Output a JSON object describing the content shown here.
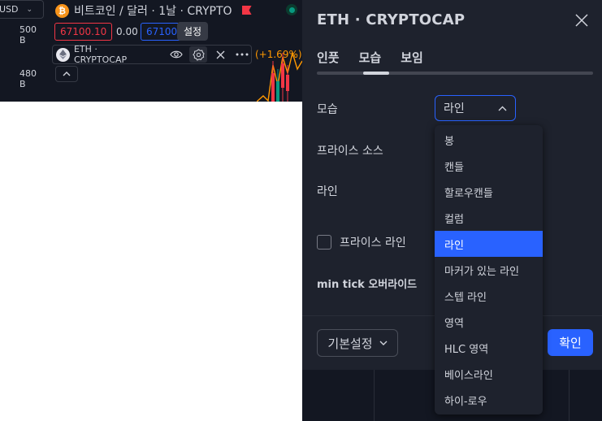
{
  "chart": {
    "currency": "USD",
    "y_labels": [
      "500 B",
      "480 B"
    ],
    "symbol_title": "비트코인 / 달러 · 1날 · CRYPTO",
    "btc_glyph": "₿",
    "sell_price": "67100.10",
    "spread": "0.00",
    "buy_price": "67100.",
    "tooltip": "설정",
    "legend_symbol": "ETH · CRYPTOCAP",
    "legend_change": "(+1.69%)",
    "collapse_glyph": "^",
    "accent_colors": {
      "sell": "#f23645",
      "buy": "#2962ff",
      "change": "#ff9800",
      "live": "#089981"
    }
  },
  "dialog": {
    "title": "ETH · CRYPTOCAP",
    "tabs": [
      {
        "label": "인풋",
        "active": false
      },
      {
        "label": "모습",
        "active": true
      },
      {
        "label": "보임",
        "active": false
      }
    ],
    "rows": {
      "style_label": "모습",
      "price_source_label": "프라이스 소스",
      "line_label": "라인",
      "price_line_label": "프라이스 라인",
      "min_tick_label": "min tick 오버라이드"
    },
    "style_select_value": "라인",
    "defaults_button": "기본설정",
    "ok_button": "확인"
  },
  "dropdown": {
    "items": [
      "봉",
      "캔들",
      "할로우캔들",
      "컬럼",
      "라인",
      "마커가 있는 라인",
      "스텝 라인",
      "영역",
      "HLC 영역",
      "베이스라인",
      "하이-로우"
    ],
    "selected": "라인"
  }
}
